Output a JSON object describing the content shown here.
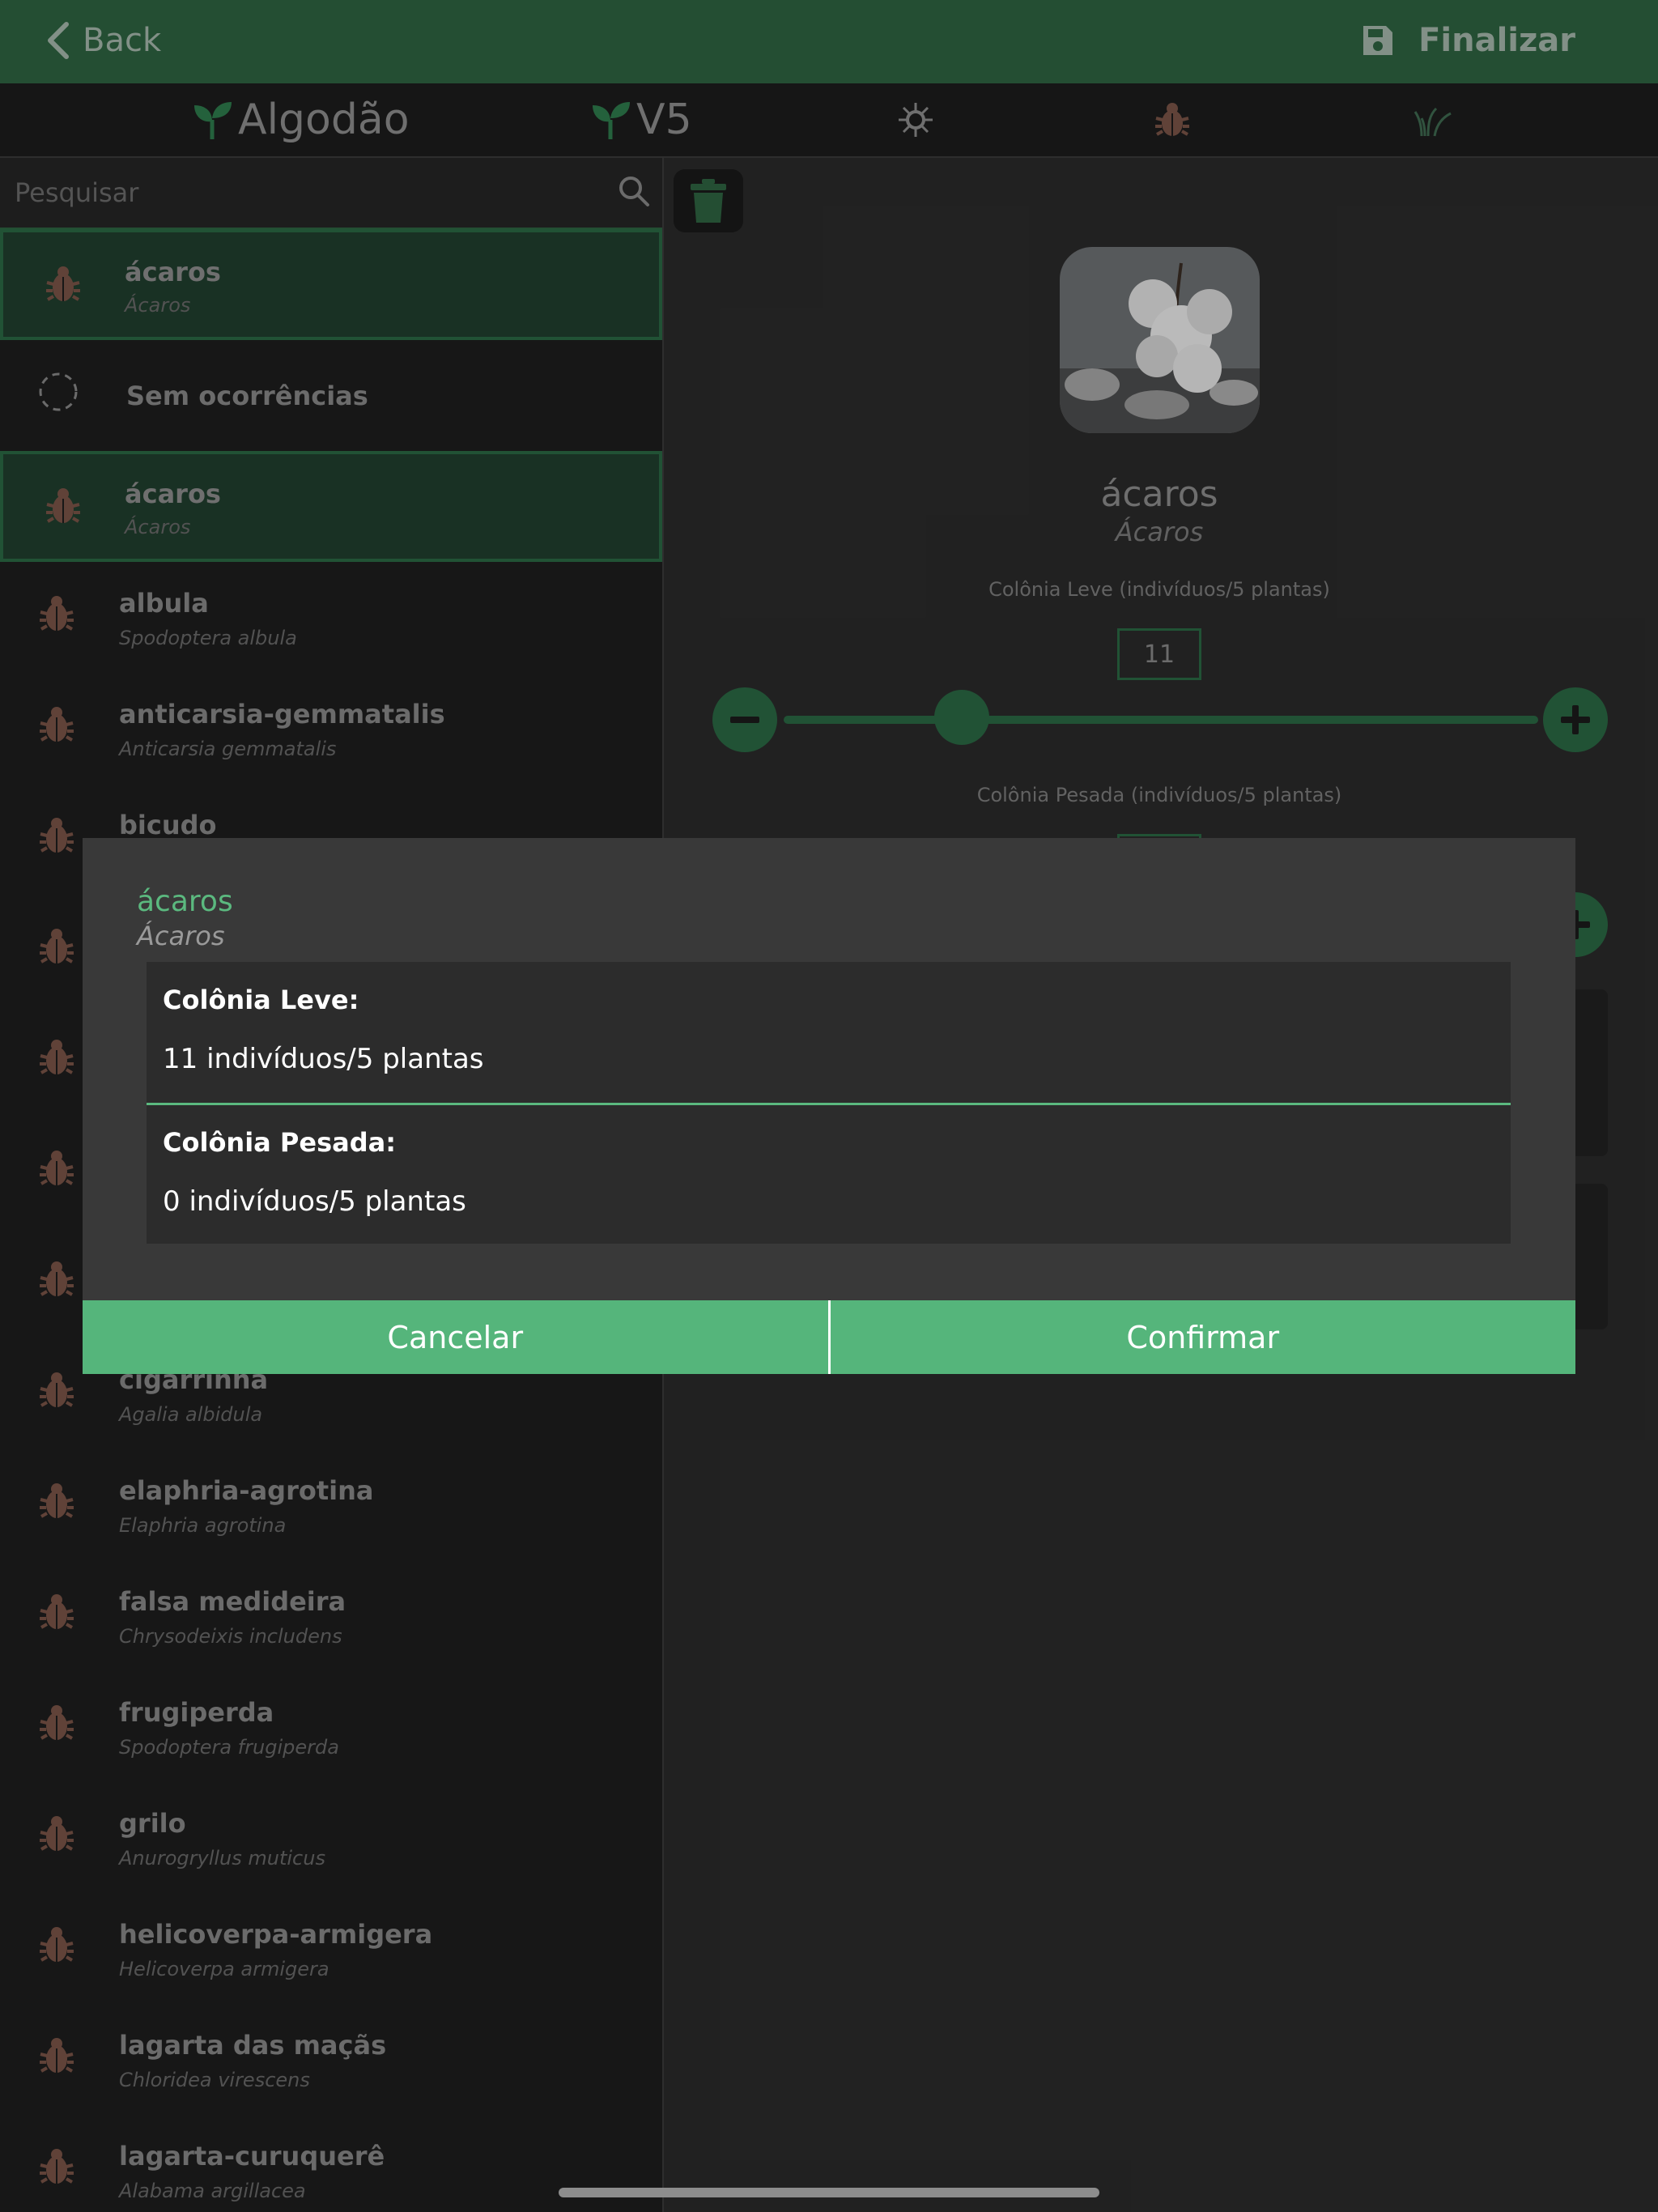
{
  "header": {
    "back_label": "Back",
    "finalize_label": "Finalizar"
  },
  "tabs": {
    "crop": "Algodão",
    "stage": "V5"
  },
  "colors": {
    "brand_green": "#2f6442",
    "accent": "#55b57b",
    "pest_icon": "#7c5548"
  },
  "search": {
    "placeholder": "Pesquisar"
  },
  "list": [
    {
      "name": "ácaros",
      "sci": "Ácaros",
      "selected": true
    },
    {
      "name": "Sem ocorrências",
      "sci": "",
      "none": true
    },
    {
      "name": "ácaros",
      "sci": "Ácaros",
      "selected": true
    },
    {
      "name": "albula",
      "sci": "Spodoptera albula"
    },
    {
      "name": "anticarsia-gemmatalis",
      "sci": "Anticarsia gemmatalis"
    },
    {
      "name": "bicudo",
      "sci": ""
    },
    {
      "name": "",
      "sci": ""
    },
    {
      "name": "",
      "sci": ""
    },
    {
      "name": "",
      "sci": ""
    },
    {
      "name": "",
      "sci": ""
    },
    {
      "name": "cigarrinha",
      "sci": "Agalia albidula"
    },
    {
      "name": "elaphria-agrotina",
      "sci": "Elaphria agrotina"
    },
    {
      "name": "falsa medideira",
      "sci": "Chrysodeixis includens"
    },
    {
      "name": "frugiperda",
      "sci": "Spodoptera frugiperda"
    },
    {
      "name": "grilo",
      "sci": "Anurogryllus muticus"
    },
    {
      "name": "helicoverpa-armigera",
      "sci": "Helicoverpa armigera"
    },
    {
      "name": "lagarta das maçãs",
      "sci": "Chloridea virescens"
    },
    {
      "name": "lagarta-curuquerê",
      "sci": "Alabama argillacea"
    }
  ],
  "detail": {
    "name": "ácaros",
    "sci": "Ácaros",
    "leve_label": "Colônia Leve (indivíduos/5 plantas)",
    "leve_value": "11",
    "leve_slider_fraction": 0.24,
    "pesada_label": "Colônia Pesada (indivíduos/5 plantas)"
  },
  "modal": {
    "name": "ácaros",
    "sci": "Ácaros",
    "leve_title": "Colônia Leve:",
    "leve_value": "11 indivíduos/5 plantas",
    "pesada_title": "Colônia Pesada:",
    "pesada_value": "0 indivíduos/5 plantas",
    "cancel_label": "Cancelar",
    "confirm_label": "Confirmar"
  }
}
